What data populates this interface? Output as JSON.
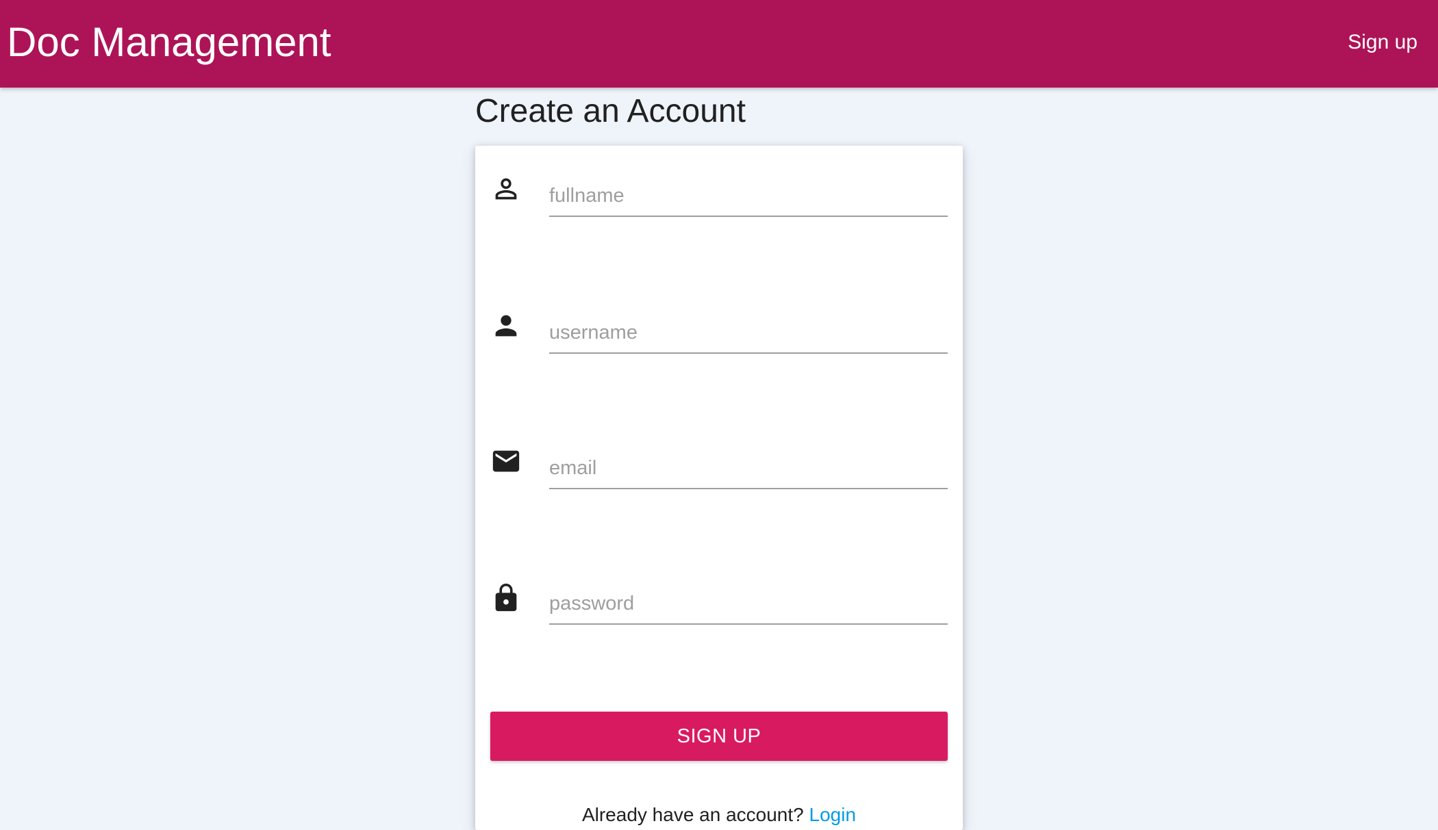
{
  "navbar": {
    "brand": "Doc Management",
    "signup_link": "Sign up",
    "color": "#ad1457"
  },
  "page": {
    "title": "Create an Account",
    "background": "#eff3fa"
  },
  "form": {
    "fields": [
      {
        "name": "fullname",
        "placeholder": "fullname",
        "icon": "person-outline-icon",
        "value": ""
      },
      {
        "name": "username",
        "placeholder": "username",
        "icon": "person-icon",
        "value": ""
      },
      {
        "name": "email",
        "placeholder": "email",
        "icon": "mail-icon",
        "value": ""
      },
      {
        "name": "password",
        "placeholder": "password",
        "icon": "lock-icon",
        "value": ""
      }
    ],
    "submit_label": "SIGN UP",
    "submit_color": "#d81b60",
    "login_prompt": "Already have an account?",
    "login_link": "Login",
    "login_link_color": "#039be5"
  }
}
